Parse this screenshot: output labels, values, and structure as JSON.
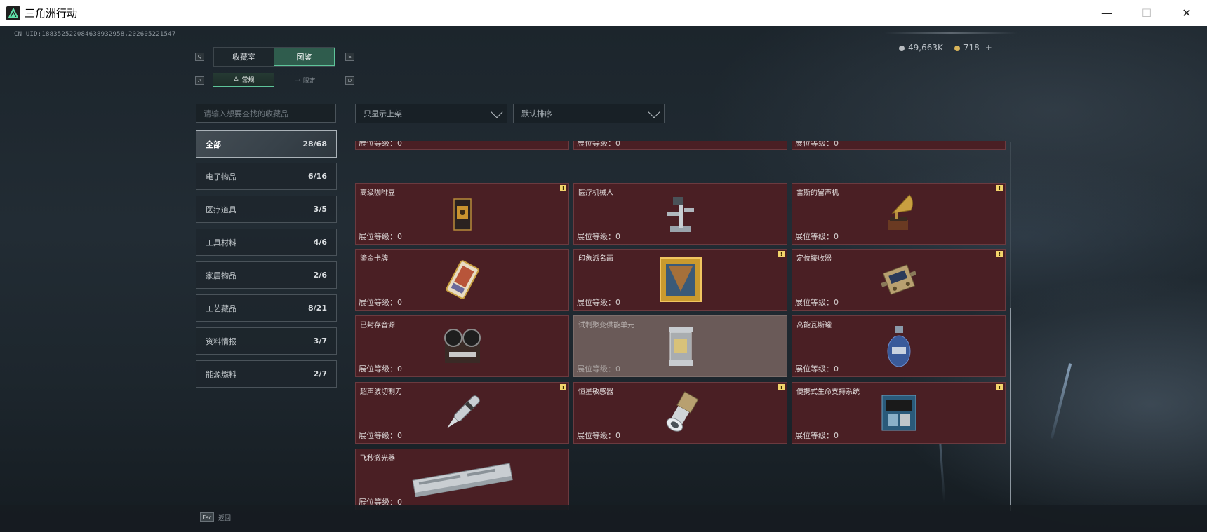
{
  "window": {
    "title": "三角洲行动",
    "minimize": "—",
    "maximize": "☐",
    "close": "✕"
  },
  "hud": {
    "uid": "CN UID:188352522084638932958,202605221547",
    "silver": "49,663K",
    "gold": "718",
    "add": "+"
  },
  "tabs": {
    "left_key": "Q",
    "right_key": "E",
    "collection_room": "收藏室",
    "catalog": "图鉴",
    "sub_left_key": "A",
    "sub_right_key": "D",
    "regular": "常规",
    "limited": "限定"
  },
  "search": {
    "placeholder": "请输入想要查找的收藏品"
  },
  "filters": {
    "show_filter": "只显示上架",
    "sort": "默认排序"
  },
  "categories": [
    {
      "label": "全部",
      "count": "28/68"
    },
    {
      "label": "电子物品",
      "count": "6/16"
    },
    {
      "label": "医疗道具",
      "count": "3/5"
    },
    {
      "label": "工具材料",
      "count": "4/6"
    },
    {
      "label": "家居物品",
      "count": "2/6"
    },
    {
      "label": "工艺藏品",
      "count": "8/21"
    },
    {
      "label": "资料情报",
      "count": "3/7"
    },
    {
      "label": "能源燃料",
      "count": "2/7"
    }
  ],
  "level_label": "展位等级：",
  "items": [
    {
      "name": "",
      "level": "0"
    },
    {
      "name": "",
      "level": "0"
    },
    {
      "name": "",
      "level": "0"
    },
    {
      "name": "高级咖啡豆",
      "level": "0",
      "badge": "!"
    },
    {
      "name": "医疗机械人",
      "level": "0"
    },
    {
      "name": "雷斯的留声机",
      "level": "0",
      "badge": "!"
    },
    {
      "name": "鎏金卡牌",
      "level": "0"
    },
    {
      "name": "印象派名画",
      "level": "0",
      "badge": "!"
    },
    {
      "name": "定位接收器",
      "level": "0",
      "badge": "!"
    },
    {
      "name": "已封存音源",
      "level": "0"
    },
    {
      "name": "试制聚变供能单元",
      "level": "0"
    },
    {
      "name": "高能瓦斯罐",
      "level": "0"
    },
    {
      "name": "超声波切割刀",
      "level": "0",
      "badge": "!"
    },
    {
      "name": "恒星敏感器",
      "level": "0",
      "badge": "!"
    },
    {
      "name": "便携式生命支持系统",
      "level": "0",
      "badge": "!"
    },
    {
      "name": "飞秒激光器",
      "level": "0"
    }
  ],
  "footer": {
    "esc_key": "Esc",
    "back": "返回"
  },
  "colors": {
    "accent": "#5ec49a",
    "card_bg": "#4a1f24",
    "card_dim_bg": "#6a5a58",
    "badge": "#f2d46b"
  }
}
